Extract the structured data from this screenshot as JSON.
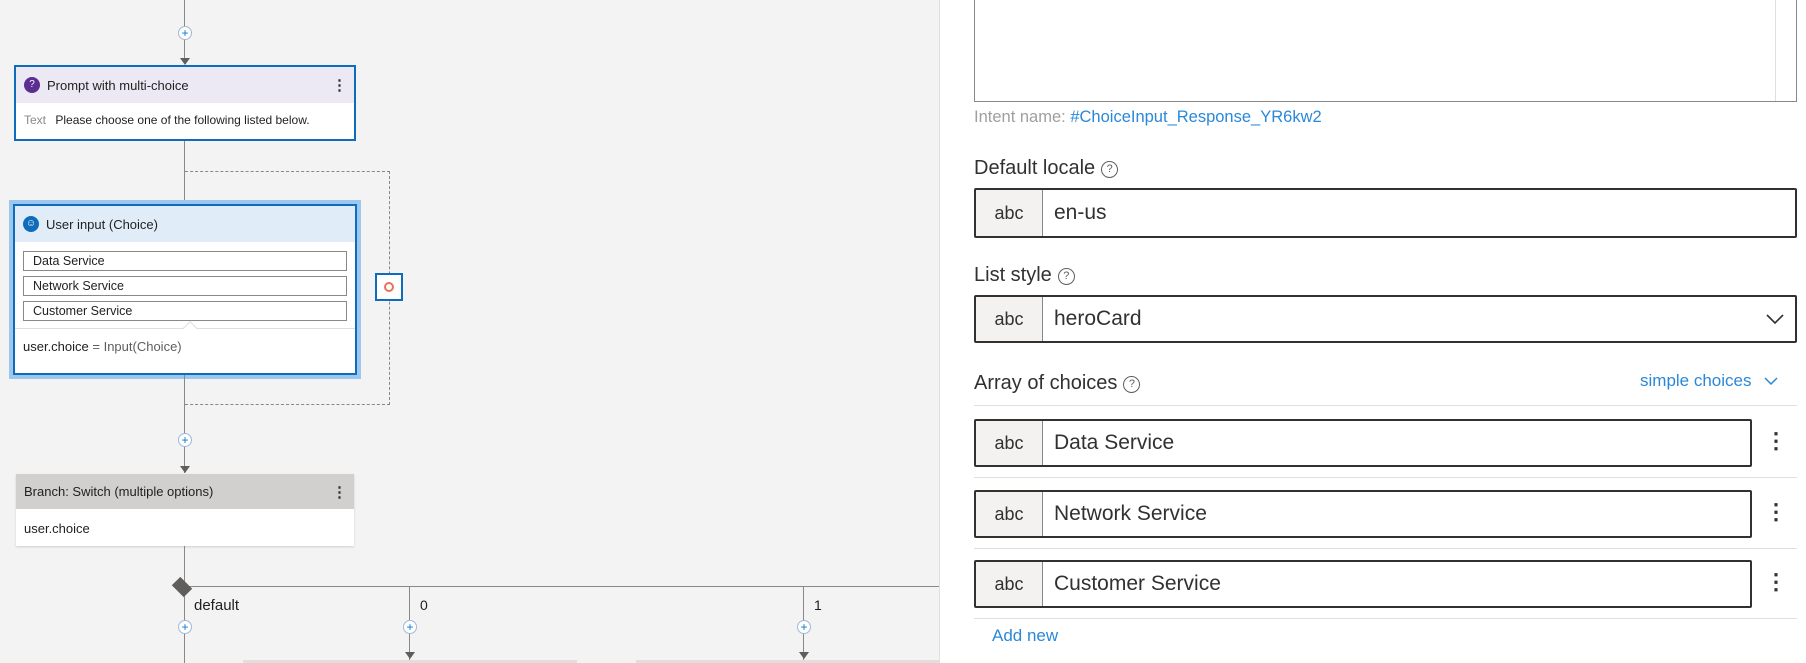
{
  "canvas": {
    "prompt_node": {
      "title": "Prompt with multi-choice",
      "text_label": "Text",
      "text_value": "Please choose one of the following listed below."
    },
    "input_node": {
      "title": "User input (Choice)",
      "choices": [
        "Data Service",
        "Network Service",
        "Customer Service"
      ],
      "assign_var": "user.choice",
      "assign_eq": " = ",
      "assign_expr": "Input(Choice)"
    },
    "switch_node": {
      "title": "Branch: Switch (multiple options)",
      "condition": "user.choice"
    },
    "branches": [
      "default",
      "0",
      "1"
    ]
  },
  "panel": {
    "intent_label": "Intent name:",
    "intent_value": "#ChoiceInput_Response_YR6kw2",
    "default_locale": {
      "label": "Default locale",
      "prefix": "abc",
      "value": "en-us"
    },
    "list_style": {
      "label": "List style",
      "prefix": "abc",
      "value": "heroCard"
    },
    "array_of_choices": {
      "label": "Array of choices",
      "mode": "simple choices",
      "items": [
        {
          "prefix": "abc",
          "value": "Data Service"
        },
        {
          "prefix": "abc",
          "value": "Network Service"
        },
        {
          "prefix": "abc",
          "value": "Customer Service"
        }
      ],
      "add_new": "Add new"
    }
  },
  "colors": {
    "accent": "#0f6cbd",
    "link": "#2b88d8",
    "selected_glow": "#9cc8f0"
  }
}
